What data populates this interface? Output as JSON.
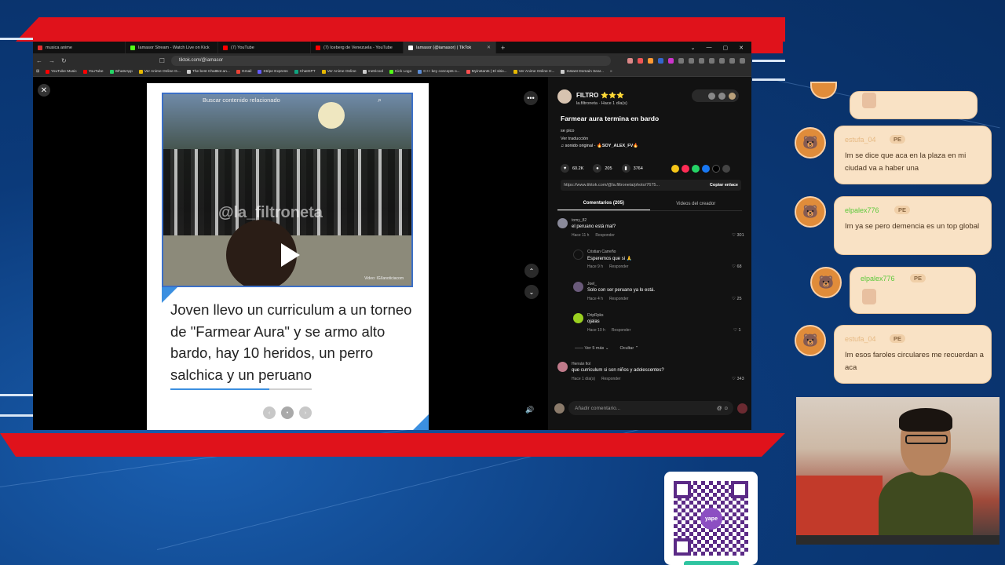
{
  "browser": {
    "tabs": [
      {
        "label": "musica anime",
        "color": "#e03030",
        "active": false
      },
      {
        "label": "Iamasor Stream - Watch Live on Kick",
        "color": "#53fc18",
        "active": false
      },
      {
        "label": "(7) YouTube",
        "color": "#ff0000",
        "active": false
      },
      {
        "label": "(7) Iceberg de Venezuela - YouTube",
        "color": "#ff0000",
        "active": false
      },
      {
        "label": "Iamasor (@iamasor) | TikTok",
        "color": "#ffffff",
        "active": true
      }
    ],
    "url": "tiktok.com/@iamasor",
    "bookmarks": [
      {
        "label": "YouTube Music",
        "color": "#ff0000"
      },
      {
        "label": "YouTube",
        "color": "#ff0000"
      },
      {
        "label": "WhatsApp",
        "color": "#25d366"
      },
      {
        "label": "Ver Anime Online G...",
        "color": "#e6b800"
      },
      {
        "label": "The best ChatBot an...",
        "color": "#cccccc"
      },
      {
        "label": "Gmail",
        "color": "#ea4335"
      },
      {
        "label": "Stripe Express",
        "color": "#635bff"
      },
      {
        "label": "ChatGPT",
        "color": "#10a37f"
      },
      {
        "label": "Ver Anime Online",
        "color": "#e6b800"
      },
      {
        "label": "metricool",
        "color": "#cccccc"
      },
      {
        "label": "Kick Logo",
        "color": "#53fc18"
      },
      {
        "label": "C++ key concepts o...",
        "color": "#5c8dd6"
      },
      {
        "label": "Myinstants | El sitio...",
        "color": "#ff5050"
      },
      {
        "label": "Ver Anime Online H...",
        "color": "#e6b800"
      },
      {
        "label": "Instant Domain Sear...",
        "color": "#cccccc"
      }
    ]
  },
  "post": {
    "video_search": "Buscar contenido relacionado",
    "watermark": "@la_filtroneta",
    "video_credit": "Video: IG/lanoticiacom",
    "headline": "Joven llevo un curriculum a un torneo de \"Farmear Aura\" y se armo alto bardo, hay 10 heridos, un perro salchica y un peruano",
    "progress": 0.7
  },
  "panel": {
    "author": "FILTRO",
    "stars": "⭐⭐⭐",
    "author_sub": "la.filtroneta · Hace 1 día(s)",
    "title": "Farmear aura termina en bardo",
    "desc_1": "se pico",
    "desc_2": "Ver traducción",
    "sound_prefix": "♫ sonido original - ",
    "sound_user": "🔥SOY_ALEX_FV🔥",
    "likes": "60.2K",
    "comments_count": "205",
    "saves": "3764",
    "link": "https://www.tiktok.com/@la.filtroneta/photo/7675...",
    "copy_label": "Copiar enlace",
    "tab_comments": "Comentarios (205)",
    "tab_creator": "Videos del creador",
    "comments": [
      {
        "user": "tomy_82",
        "text": "el peruano está mal?",
        "time": "Hace 11 h",
        "likes": "301"
      },
      {
        "user": "Cristian Carreño",
        "text": "Esperemos que si 🙏",
        "time": "Hace 9 h",
        "likes": "68"
      },
      {
        "user": "Joel_",
        "text": "Solo con ser peruano ya lo está.",
        "time": "Hace 4 h",
        "likes": "25"
      },
      {
        "user": "DripRpks",
        "text": "ojalas",
        "time": "Hace 10 h",
        "likes": "1"
      },
      {
        "user": "Hernán fiol",
        "text": "que curriculum si son niños y adolescentes?",
        "time": "Hace 1 día(s)",
        "likes": "343"
      }
    ],
    "reply_label": "Responder",
    "more_replies": "Ver 5 más",
    "hide_label": "Ocultar",
    "add_comment_placeholder": "Añadir comentario..."
  },
  "chat": [
    {
      "user": "estufa_04",
      "badge": "PE",
      "text": "Im se dice que aca en la plaza en mi ciudad va a haber una",
      "green": false
    },
    {
      "user": "elpalex776",
      "badge": "PE",
      "text": "Im ya se pero demencia es un top global",
      "green": true
    },
    {
      "user": "elpalex776",
      "badge": "PE",
      "text": "",
      "green": true
    },
    {
      "user": "estufa_04",
      "badge": "PE",
      "text": "Im esos faroles circulares me recuerdan a aca",
      "green": false
    }
  ],
  "qr": {
    "brand": "yape"
  }
}
